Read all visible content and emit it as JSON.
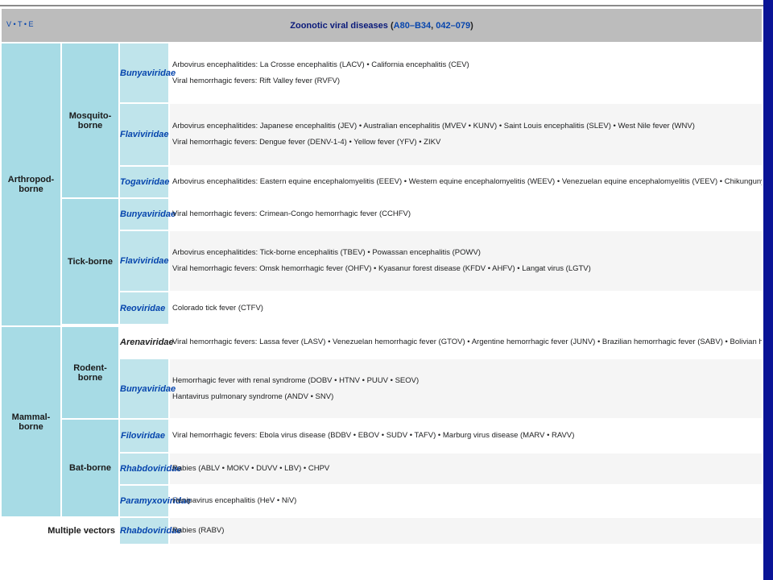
{
  "header": {
    "vte": "V • T • E",
    "title": "Zoonotic viral diseases",
    "codes_open": " (",
    "codes_a": "A80–B34",
    "codes_sep": ", ",
    "codes_b": "042–079",
    "codes_close": ")"
  },
  "groups": {
    "arthropod": "Arthropod-borne",
    "mammal": "Mammal-borne",
    "multiple": "Multiple vectors"
  },
  "subgroups": {
    "mosquito": "Mosquito-borne",
    "tick": "Tick-borne",
    "rodent": "Rodent-borne",
    "bat": "Bat-borne"
  },
  "families": {
    "m_bunya": "Bunyaviridae",
    "m_flavi": "Flaviviridae",
    "m_toga": "Togaviridae",
    "t_bunya": "Bunyaviridae",
    "t_flavi": "Flaviviridae",
    "t_reo": "Reoviridae",
    "r_arena": "Arenaviridae",
    "r_bunya": "Bunyaviridae",
    "b_filo": "Filoviridae",
    "b_rhabdo": "Rhabdoviridae",
    "b_paramyxo": "Paramyxoviridae",
    "mv_rhabdo": "Rhabdoviridae"
  },
  "lists": {
    "m_bunya_1": "Arbovirus encephalitides: La Crosse encephalitis (LACV) • California encephalitis (CEV)",
    "m_bunya_2": "Viral hemorrhagic fevers: Rift Valley fever (RVFV)",
    "m_flavi_1": "Arbovirus encephalitides: Japanese encephalitis (JEV) • Australian encephalitis (MVEV • KUNV) • Saint Louis encephalitis (SLEV) • West Nile fever (WNV)",
    "m_flavi_2": "Viral hemorrhagic fevers: Dengue fever (DENV-1-4) • Yellow fever (YFV) • ZIKV",
    "m_toga_1": "Arbovirus encephalitides: Eastern equine encephalomyelitis (EEEV) • Western equine encephalomyelitis (WEEV) • Venezuelan equine encephalomyelitis (VEEV) • Chikungunya (CHIKV) • O'Nyong-nyong fever (ONNV) • Ross River fever (RRV)",
    "t_bunya_1": "Viral hemorrhagic fevers: Crimean-Congo hemorrhagic fever (CCHFV)",
    "t_flavi_1": "Arbovirus encephalitides: Tick-borne encephalitis (TBEV) • Powassan encephalitis (POWV)",
    "t_flavi_2": "Viral hemorrhagic fevers: Omsk hemorrhagic fever (OHFV) • Kyasanur forest disease (KFDV • AHFV) • Langat virus (LGTV)",
    "t_reo_1": "Colorado tick fever (CTFV)",
    "r_arena_1": "Viral hemorrhagic fevers: Lassa fever (LASV) • Venezuelan hemorrhagic fever (GTOV) • Argentine hemorrhagic fever (JUNV) • Brazilian hemorrhagic fever (SABV) • Bolivian hemorrhagic fever (MACV) • LUJV • CHPV",
    "r_bunya_1": "Hemorrhagic fever with renal syndrome (DOBV • HTNV • PUUV • SEOV)",
    "r_bunya_2": "Hantavirus pulmonary syndrome (ANDV • SNV)",
    "b_filo_1": "Viral hemorrhagic fevers: Ebola virus disease (BDBV • EBOV • SUDV • TAFV) • Marburg virus disease (MARV • RAVV)",
    "b_rhabdo_1": "Rabies (ABLV • MOKV • DUVV • LBV) • CHPV",
    "b_paramyxo_1": "Henipavirus encephalitis (HeV • NiV)",
    "mv_rhabdo_1": "Rabies (RABV)"
  },
  "colors": {
    "header_bg": "#bcbcbc",
    "group_bg": "#a7dbe5",
    "family_bg": "#bfe4eb",
    "link": "#0645ad",
    "right_bar": "#0a1496"
  }
}
